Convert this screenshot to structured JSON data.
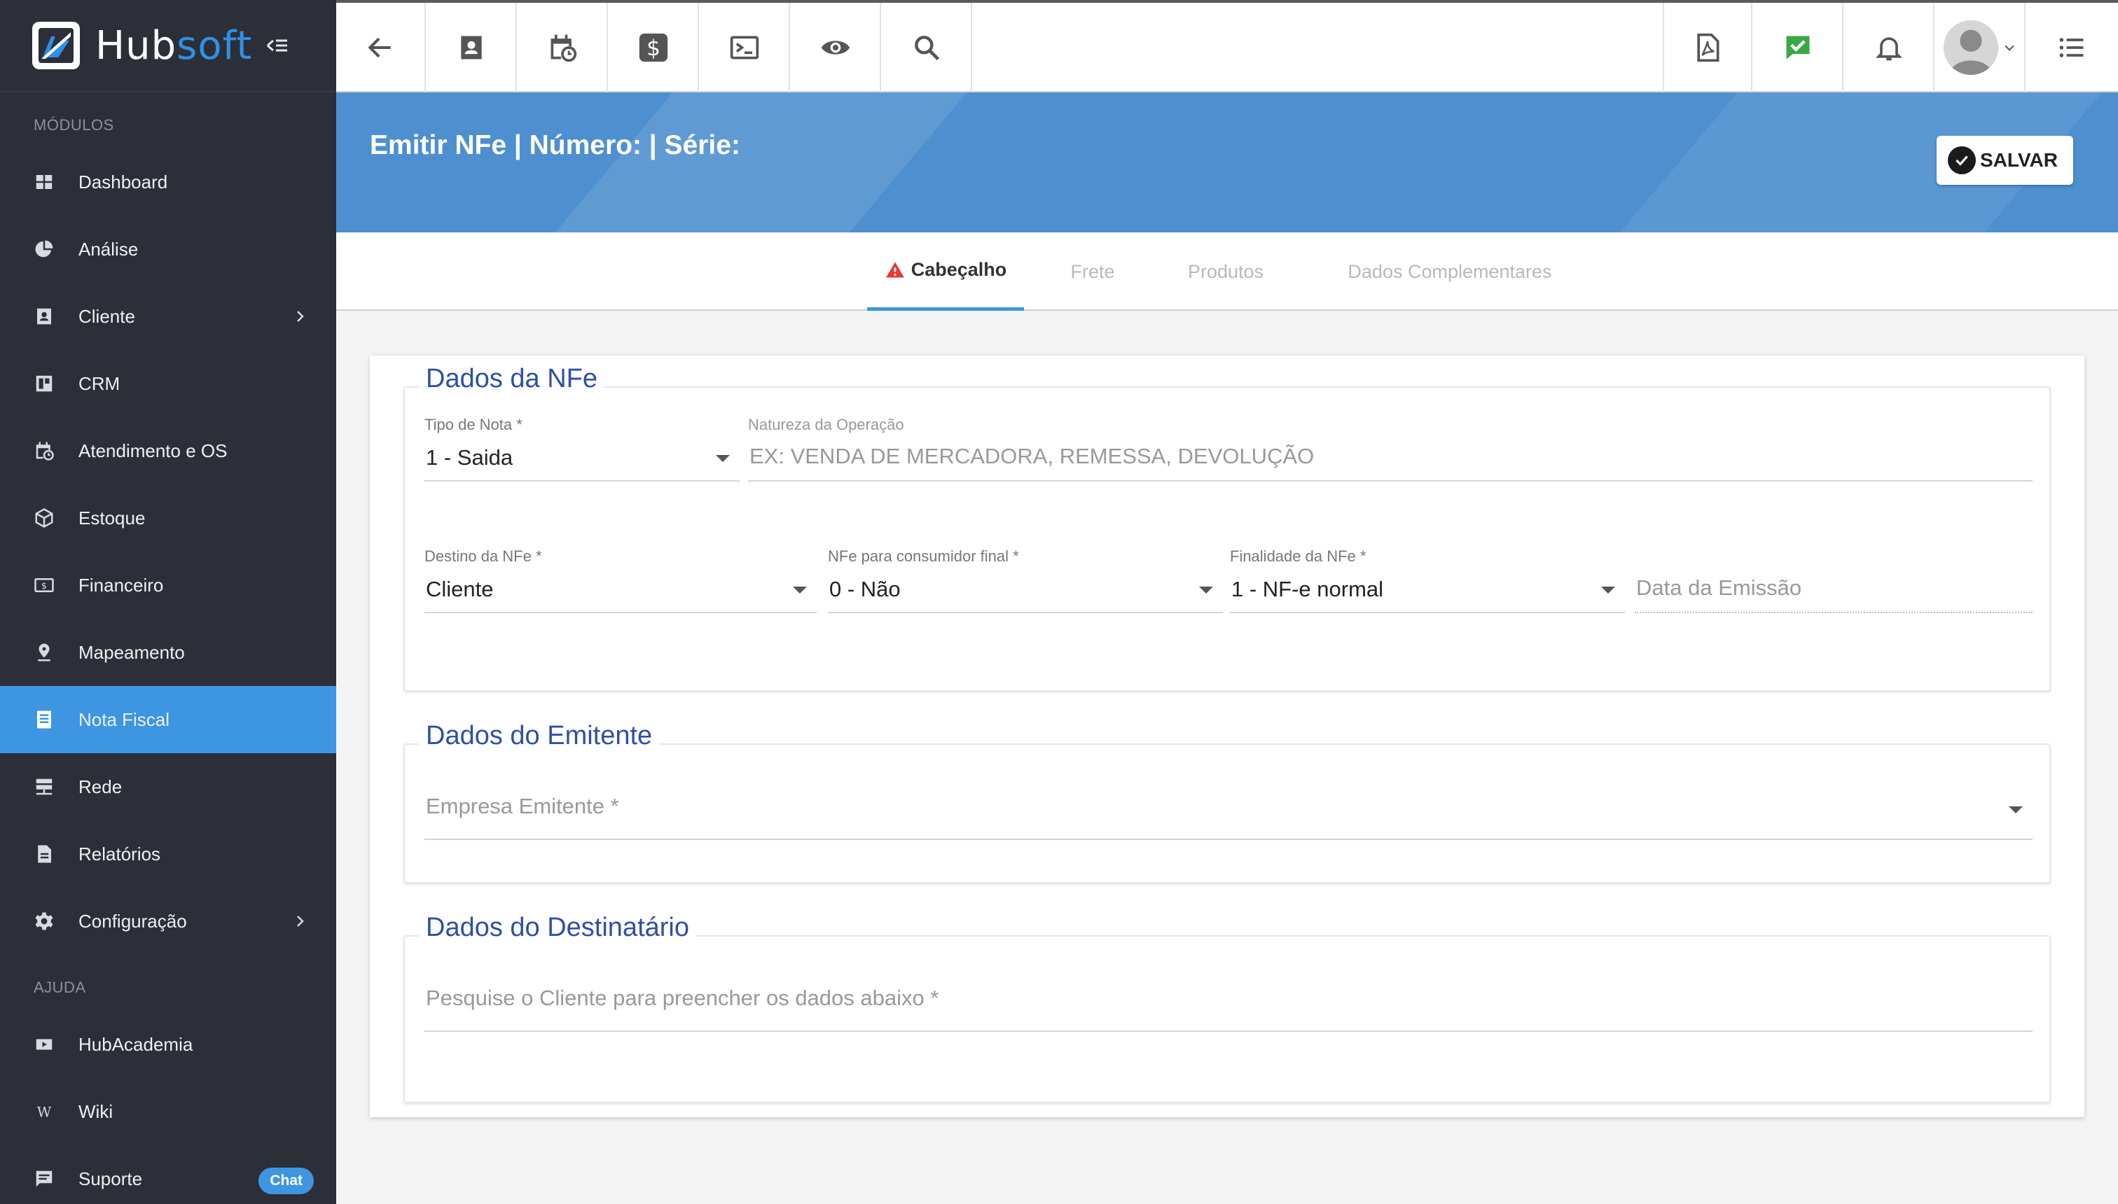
{
  "brand": {
    "hub": "Hub",
    "soft": "soft"
  },
  "sidebar": {
    "section_modulos": "MÓDULOS",
    "section_ajuda": "AJUDA",
    "items": [
      {
        "label": "Dashboard",
        "icon": "dashboard-icon"
      },
      {
        "label": "Análise",
        "icon": "pie-chart-icon"
      },
      {
        "label": "Cliente",
        "icon": "contact-card-icon",
        "has_submenu": true
      },
      {
        "label": "CRM",
        "icon": "kanban-icon"
      },
      {
        "label": "Atendimento e OS",
        "icon": "calendar-clock-icon"
      },
      {
        "label": "Estoque",
        "icon": "box-icon"
      },
      {
        "label": "Financeiro",
        "icon": "money-icon"
      },
      {
        "label": "Mapeamento",
        "icon": "map-pin-icon"
      },
      {
        "label": "Nota Fiscal",
        "icon": "document-icon",
        "active": true
      },
      {
        "label": "Rede",
        "icon": "server-icon"
      },
      {
        "label": "Relatórios",
        "icon": "report-icon"
      },
      {
        "label": "Configuração",
        "icon": "gear-icon",
        "has_submenu": true
      }
    ],
    "help_items": [
      {
        "label": "HubAcademia",
        "icon": "youtube-icon"
      },
      {
        "label": "Wiki",
        "icon": "wikipedia-icon"
      },
      {
        "label": "Suporte",
        "icon": "chat-icon",
        "badge": "Chat"
      }
    ]
  },
  "header": {
    "title": "Emitir NFe | Número: | Série:",
    "save_label": "SALVAR"
  },
  "tabs": [
    {
      "label": "Cabeçalho",
      "active": true,
      "warning": true
    },
    {
      "label": "Frete"
    },
    {
      "label": "Produtos"
    },
    {
      "label": "Dados Complementares"
    }
  ],
  "form": {
    "dados_nfe": {
      "legend": "Dados da NFe",
      "tipo_nota": {
        "label": "Tipo de Nota",
        "value": "1 - Saida"
      },
      "natureza": {
        "label": "Natureza da Operação",
        "placeholder": "EX: VENDA DE MERCADORA, REMESSA, DEVOLUÇÃO"
      },
      "destino": {
        "label": "Destino da NFe",
        "value": "Cliente"
      },
      "consumidor": {
        "label": "NFe para consumidor final",
        "value": "0 - Não"
      },
      "finalidade": {
        "label": "Finalidade da NFe",
        "value": "1 - NF-e normal"
      },
      "data_emissao": {
        "placeholder": "Data da Emissão"
      }
    },
    "dados_emitente": {
      "legend": "Dados do Emitente",
      "empresa": {
        "placeholder": "Empresa Emitente"
      }
    },
    "dados_destinatario": {
      "legend": "Dados do Destinatário",
      "pesquisa": {
        "placeholder": "Pesquise o Cliente para preencher os dados abaixo"
      }
    },
    "required_mark": "*"
  },
  "colors": {
    "accent": "#3e96e2",
    "sidebar": "#2c2f38",
    "banner": "#4e8fcf",
    "legend": "#2f4fa8",
    "success": "#3aa845"
  }
}
